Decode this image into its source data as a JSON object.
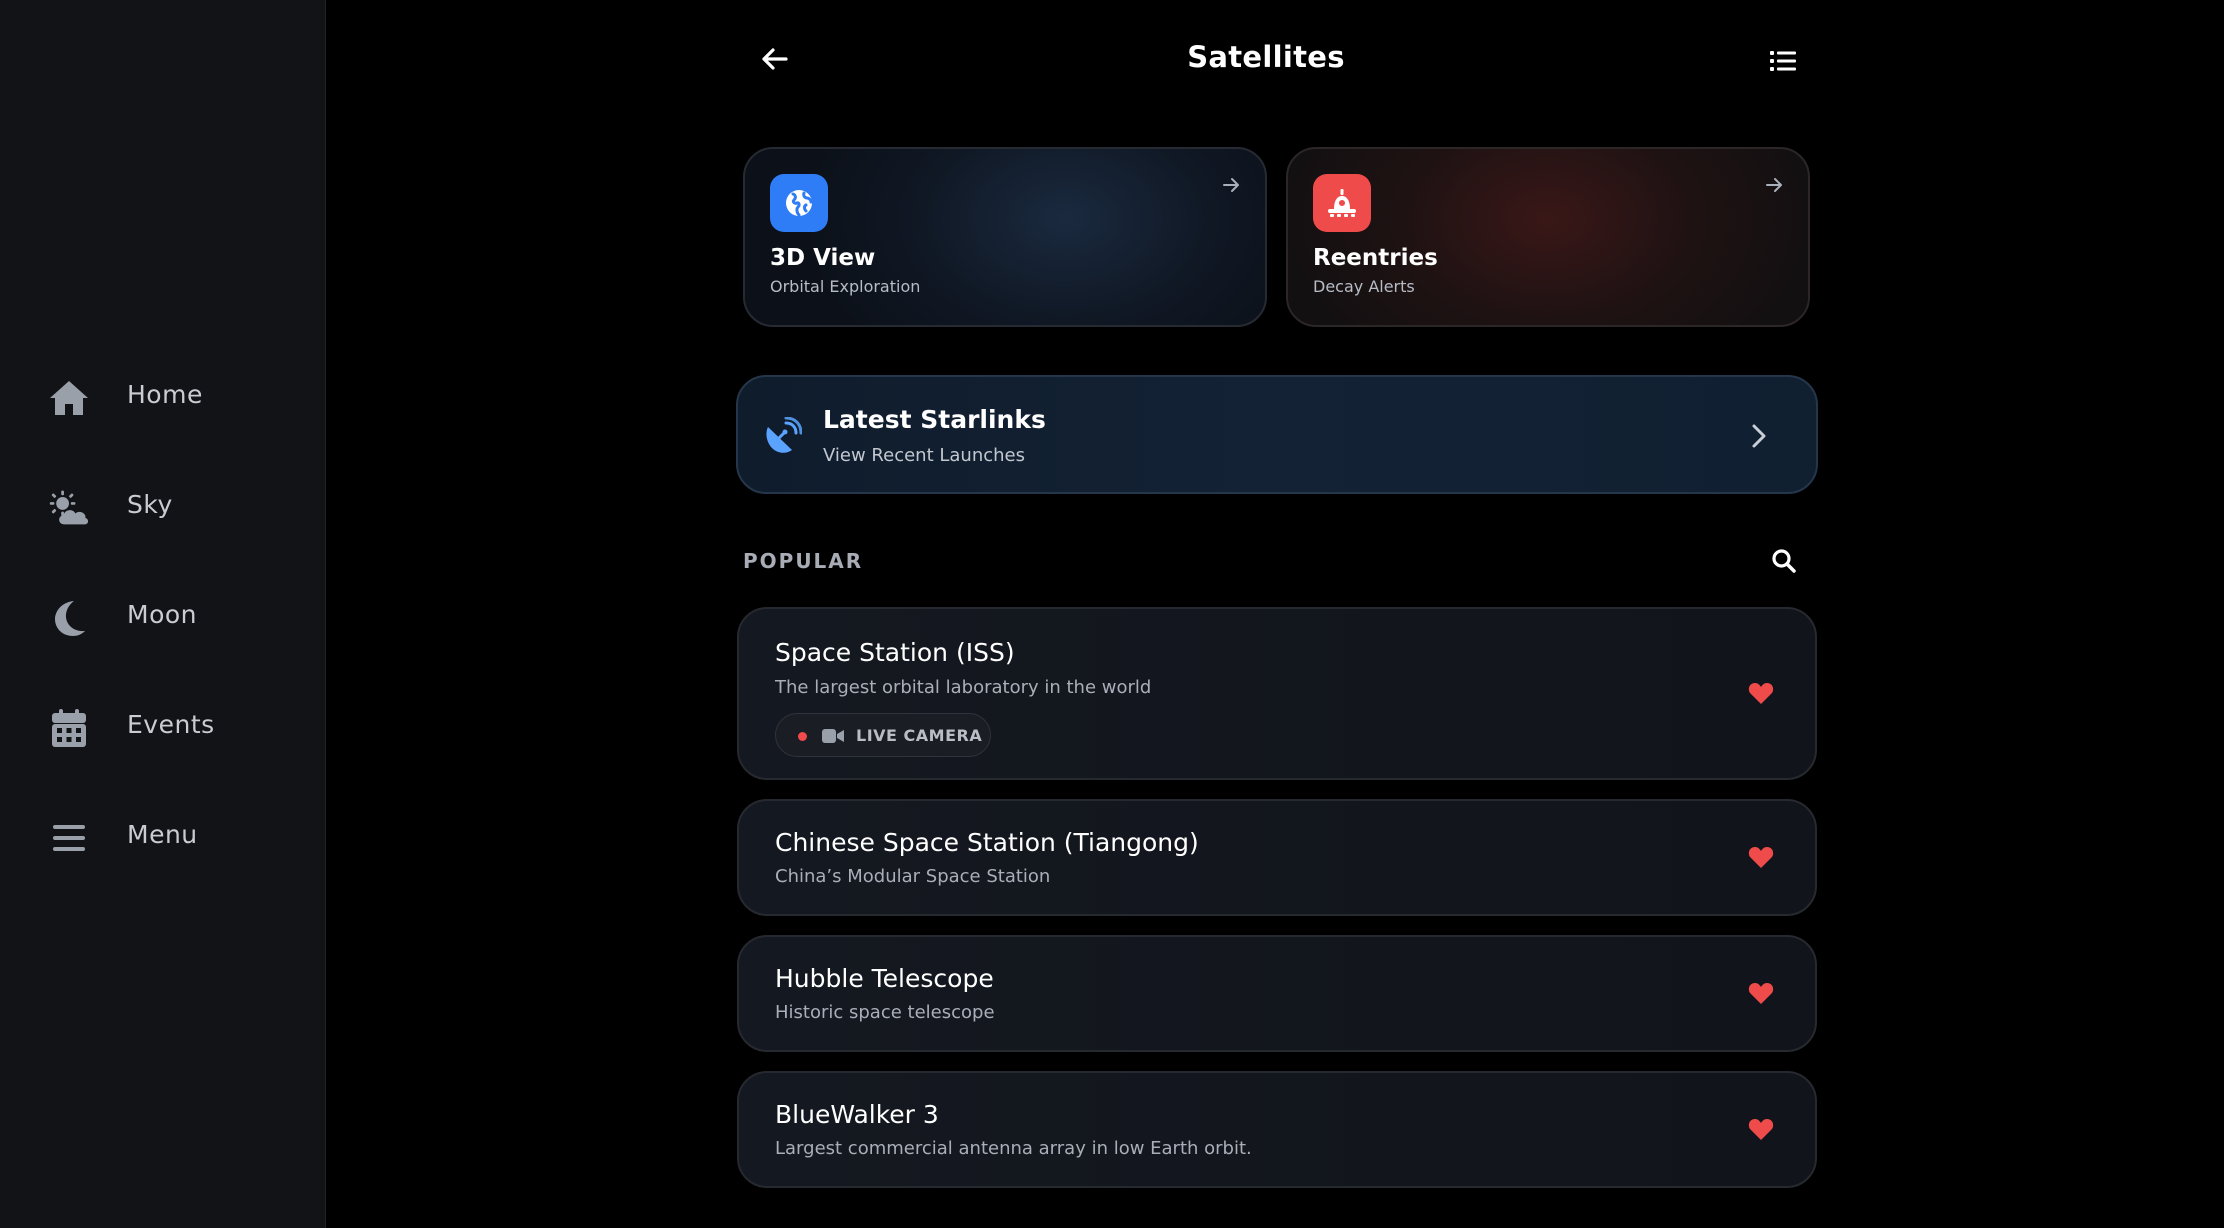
{
  "sidebar": {
    "items": [
      {
        "label": "Home",
        "icon": "home-icon"
      },
      {
        "label": "Sky",
        "icon": "sun-cloud-icon"
      },
      {
        "label": "Moon",
        "icon": "moon-icon"
      },
      {
        "label": "Events",
        "icon": "calendar-icon"
      },
      {
        "label": "Menu",
        "icon": "hamburger-icon"
      }
    ]
  },
  "header": {
    "title": "Satellites",
    "back_icon": "arrow-left-icon",
    "list_icon": "list-icon"
  },
  "quick_cards": [
    {
      "title": "3D View",
      "subtitle": "Orbital Exploration",
      "icon": "globe-icon",
      "accent": "#2f7df6"
    },
    {
      "title": "Reentries",
      "subtitle": "Decay Alerts",
      "icon": "reentry-capsule-icon",
      "accent": "#ef4b4b"
    }
  ],
  "starlink": {
    "title": "Latest Starlinks",
    "subtitle": "View Recent Launches",
    "icon": "satellite-dish-icon"
  },
  "popular": {
    "label": "POPULAR",
    "search_icon": "search-icon",
    "items": [
      {
        "name": "Space Station (ISS)",
        "description": "The largest orbital laboratory in the world",
        "badge": "LIVE CAMERA",
        "favorite": true
      },
      {
        "name": "Chinese Space Station (Tiangong)",
        "description": "China’s Modular Space Station",
        "favorite": true
      },
      {
        "name": "Hubble Telescope",
        "description": "Historic space telescope",
        "favorite": true
      },
      {
        "name": "BlueWalker 3",
        "description": "Largest commercial antenna array in low Earth orbit.",
        "favorite": true
      }
    ]
  },
  "colors": {
    "favorite": "#ef4b4b",
    "live_dot": "#ef4b4b"
  }
}
